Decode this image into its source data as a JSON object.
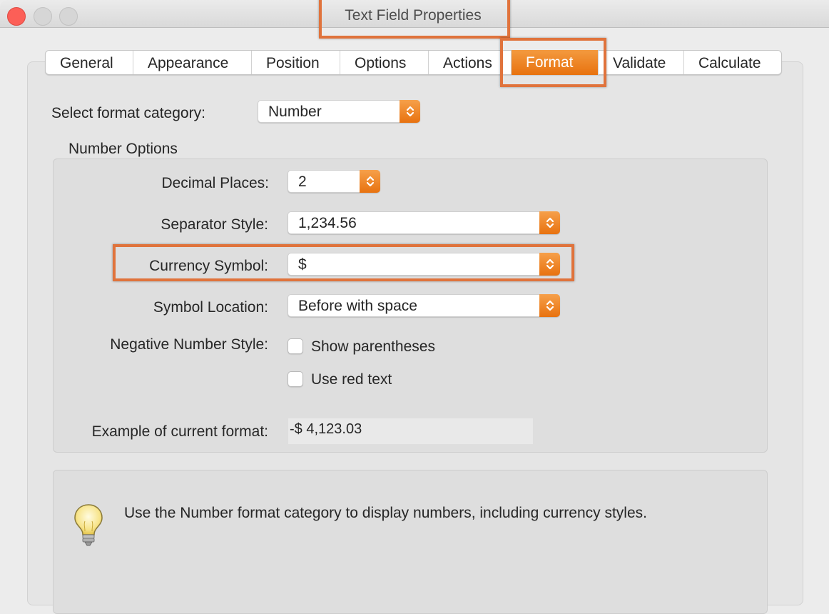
{
  "window": {
    "title": "Text Field Properties"
  },
  "tabs": [
    {
      "label": "General"
    },
    {
      "label": "Appearance"
    },
    {
      "label": "Position"
    },
    {
      "label": "Options"
    },
    {
      "label": "Actions"
    },
    {
      "label": "Format"
    },
    {
      "label": "Validate"
    },
    {
      "label": "Calculate"
    }
  ],
  "active_tab": "Format",
  "format": {
    "category_label": "Select format category:",
    "category_value": "Number",
    "number_options_title": "Number Options",
    "decimal_places_label": "Decimal Places:",
    "decimal_places_value": "2",
    "separator_style_label": "Separator Style:",
    "separator_style_value": "1,234.56",
    "currency_symbol_label": "Currency Symbol:",
    "currency_symbol_value": "$",
    "symbol_location_label": "Symbol Location:",
    "symbol_location_value": "Before with space",
    "negative_style_label": "Negative Number Style:",
    "show_parentheses_label": "Show parentheses",
    "show_parentheses_checked": false,
    "use_red_text_label": "Use red text",
    "use_red_text_checked": false,
    "example_label": "Example of current format:",
    "example_value": "-$ 4,123.03"
  },
  "hint": {
    "text": "Use the Number format category to display numbers, including currency styles.",
    "icon": "lightbulb-icon"
  },
  "colors": {
    "accent_orange": "#e8720f",
    "annotation_box": "#e0733c",
    "close_button": "#fc5f57"
  }
}
